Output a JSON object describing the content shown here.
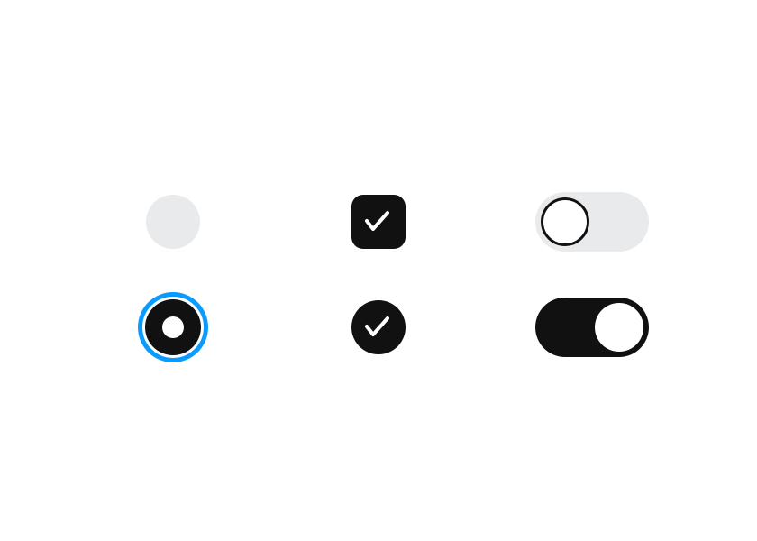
{
  "controls": {
    "radio_unchecked": {
      "checked": false
    },
    "checkbox": {
      "checked": true,
      "icon": "check-icon"
    },
    "toggle_off": {
      "on": false
    },
    "radio_checked": {
      "checked": true,
      "focused": true
    },
    "check_circle": {
      "checked": true,
      "icon": "check-icon"
    },
    "toggle_on": {
      "on": true
    }
  },
  "colors": {
    "dark": "#111111",
    "light": "#e9eaec",
    "focus": "#0a9bff",
    "white": "#ffffff"
  }
}
